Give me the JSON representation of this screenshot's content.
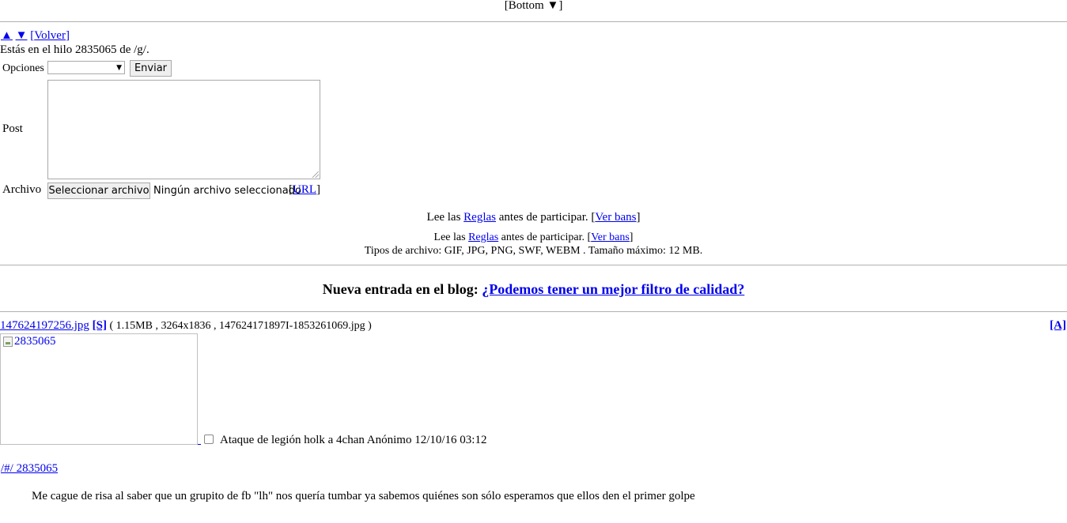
{
  "top_nav": {
    "open": "[",
    "label": "Bottom",
    "arrow": "▼",
    "close": "]"
  },
  "nav_links": {
    "up": "▲",
    "down": "▼",
    "back_open": "[",
    "back": "Volver",
    "back_close": "]"
  },
  "thread_info": "Estás en el hilo 2835065 de /g/.",
  "form": {
    "options_label": "Opciones",
    "options_selected": "",
    "send_button": "Enviar",
    "post_label": "Post",
    "post_value": "",
    "file_label": "Archivo",
    "file_button": "Seleccionar archivo",
    "file_status": "Ningún archivo seleccionado",
    "url_open": "[",
    "url_link": "URL",
    "url_close": "]"
  },
  "rules_line_1": {
    "prefix": "Lee las ",
    "rules": "Reglas",
    "middle": " antes de participar. [",
    "bans": "Ver bans",
    "suffix": "]"
  },
  "rules_line_2": {
    "prefix": "Lee las ",
    "rules": "Reglas",
    "middle": " antes de participar. [",
    "bans": "Ver bans",
    "suffix": "]"
  },
  "file_types": "Tipos de archivo: GIF, JPG, PNG, SWF, WEBM . Tamaño máximo: 12 MB.",
  "blog": {
    "prefix": "Nueva entrada en el blog: ",
    "link": "¿Podemos tener un mejor filtro de calidad?"
  },
  "post": {
    "file_name": "147624197256.jpg",
    "s_link": "[S]",
    "file_meta": " ( 1.15MB , 3264x1836 , 147624171897I-1853261069.jpg )",
    "a_link": "[A]",
    "image_alt": "2835065",
    "subject_line": "Ataque de legión holk a 4chan Anónimo 12/10/16 03:12",
    "post_link": "/#/ 2835065",
    "body": "Me cague de risa al saber que un grupito de fb \"lh\" nos quería tumbar ya sabemos quiénes son sólo esperamos que ellos den el primer golpe"
  }
}
